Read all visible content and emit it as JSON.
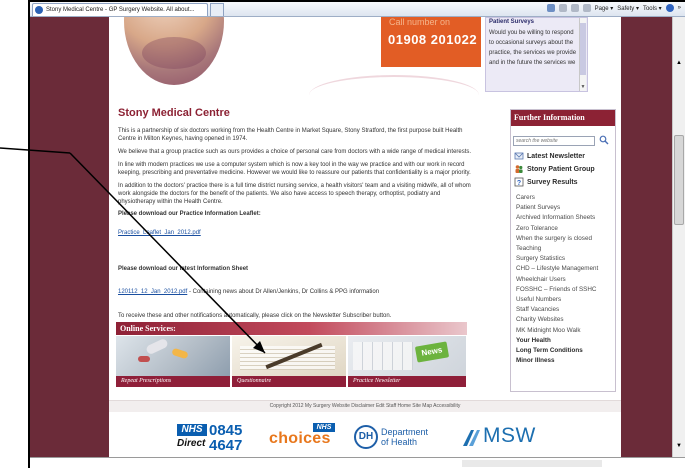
{
  "browser": {
    "tab_title": "Stony Medical Centre - GP Surgery Website. All about...",
    "commands": {
      "page": "Page ▾",
      "safety": "Safety ▾",
      "tools": "Tools ▾",
      "more": "»"
    }
  },
  "header": {
    "phone_label": "Call number on",
    "phone_number": "01908 201022",
    "patient_surveys": {
      "title": "Patient Surveys",
      "text": "Would you be willing to respond to occasional surveys about the practice, the services we provide and in the future the services we"
    }
  },
  "main": {
    "title": "Stony Medical Centre",
    "paragraphs": [
      "This is a partnership of six doctors working from the Health Centre in Market Square, Stony Stratford, the first purpose built Health Centre in Milton Keynes, having opened in 1974.",
      "We believe that a group practice such as ours provides a choice of personal care from doctors with a wide range of medical interests.",
      "In line with modern practices we use a computer system which is now a key tool in the way we practice and with our work in record keeping, prescribing and preventative medicine. However we would like to reassure our patients that confidentiality is a major priority.",
      "In addition to the doctors' practice there is a full time district nursing service, a health visitors' team and a visiting midwife, all of whom work alongside the doctors for the benefit of the patients. We also have access to speech therapy, orthoptist, podiatry and physiotherapy within the Health Centre."
    ],
    "leaflet_heading": "Please download our Practice Information Leaflet:",
    "leaflet_link": "Practice_Leaflet_Jan_2012.pdf",
    "info_heading": "Please download our latest Information Sheet",
    "info_link": "120112_12_Jan_2012.pdf",
    "info_desc": " - Containing news about Dr Allen/Jenkins, Dr Collins & PPG information",
    "newsletter_text": "To receive these and other notifications automatically, please click on the Newsletter Subscriber button."
  },
  "online_services": {
    "title": "Online Services:",
    "tiles": [
      {
        "caption": "Repeat Prescriptions"
      },
      {
        "caption": "Questionnaire"
      },
      {
        "caption": "Practice Newsletter"
      }
    ],
    "news_key": "News"
  },
  "sidebar": {
    "title": "Further Information",
    "search_placeholder": "search the website",
    "featured": [
      {
        "label": "Latest Newsletter",
        "icon": "newsletter-icon"
      },
      {
        "label": "Stony Patient Group",
        "icon": "patient-group-icon"
      },
      {
        "label": "Survey Results",
        "icon": "survey-icon"
      }
    ],
    "items": [
      "Carers",
      "Patient Surveys",
      "Archived Information Sheets",
      "Zero Tolerance",
      "When the surgery is closed",
      "Teaching",
      "Surgery Statistics",
      "CHD – Lifestyle Management",
      "Wheelchair Users",
      "FOSSHC – Friends of SSHC",
      "Useful Numbers",
      "Staff Vacancies",
      "Charity Websites",
      "MK Midnight Moo Walk"
    ],
    "bold_items": [
      "Your Health",
      "Long Term Conditions",
      "Minor Illness"
    ]
  },
  "footer": {
    "copyright": "Copyright 2012 My Surgery Website   Disclaimer   Edit   Staff Home   Site Map   Accessibility"
  },
  "logos": {
    "nhs_direct_badge": "NHS",
    "nhs_direct_word": "Direct",
    "nhs_direct_num1": "0845",
    "nhs_direct_num2": "4647",
    "nhs_choices_badge": "NHS",
    "nhs_choices_word": "choices",
    "dh_mark": "DH",
    "dh_line1": "Department",
    "dh_line2": "of Health",
    "msw_text": "MSW"
  },
  "colors": {
    "background": "#6b2b39",
    "accent": "#8c2234",
    "phone_box": "#e25d25",
    "link": "#1a4fa0"
  }
}
